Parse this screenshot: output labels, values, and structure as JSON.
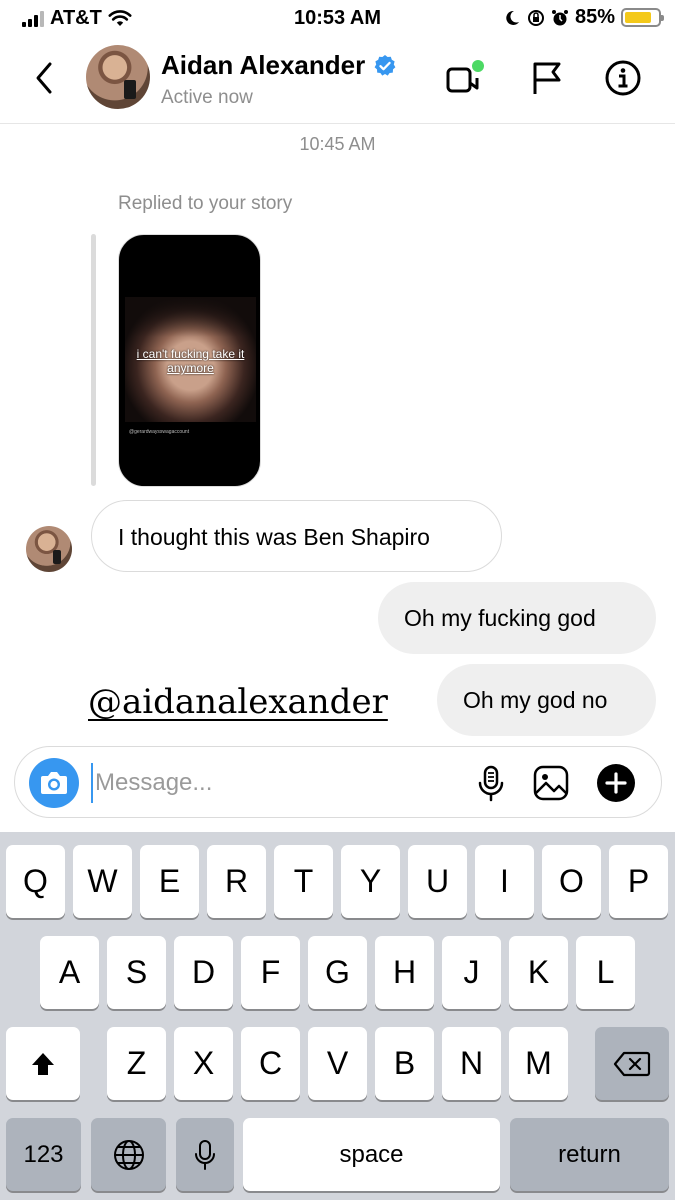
{
  "status_bar": {
    "carrier": "AT&T",
    "time": "10:53 AM",
    "battery": "85%"
  },
  "header": {
    "name": "Aidan Alexander",
    "status": "Active now"
  },
  "conversation": {
    "timestamp": "10:45 AM",
    "reply_label": "Replied to your story",
    "story_caption": "i can't fucking take it anymore",
    "story_credit": "@gerardwaysswagaccount",
    "messages": [
      {
        "from": "them",
        "text": "I thought this was Ben Shapiro"
      },
      {
        "from": "me",
        "text": "Oh my fucking god"
      },
      {
        "from": "me",
        "text": "Oh my god no"
      }
    ],
    "watermark": "@aidanalexander"
  },
  "composer": {
    "placeholder": "Message..."
  },
  "keyboard": {
    "row1": [
      "Q",
      "W",
      "E",
      "R",
      "T",
      "Y",
      "U",
      "I",
      "O",
      "P"
    ],
    "row2": [
      "A",
      "S",
      "D",
      "F",
      "G",
      "H",
      "J",
      "K",
      "L"
    ],
    "row3": [
      "Z",
      "X",
      "C",
      "V",
      "B",
      "N",
      "M"
    ],
    "numbers": "123",
    "space": "space",
    "return": "return"
  },
  "colors": {
    "accent": "#3797f0",
    "verified": "#3797f0",
    "online": "#4cd964",
    "battery": "#f4c91a"
  }
}
